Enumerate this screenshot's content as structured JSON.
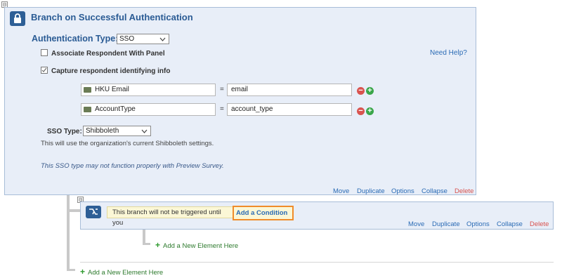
{
  "top_collapse": "⊟",
  "main": {
    "title": "Branch on Successful Authentication",
    "auth_type_label": "Authentication Type:",
    "auth_type_value": "SSO",
    "associate_label": "Associate Respondent With Panel",
    "capture_label": "Capture respondent identifying info",
    "need_help": "Need Help?",
    "rows": [
      {
        "field": "HKU Email",
        "equals": "=",
        "value": "email"
      },
      {
        "field": "AccountType",
        "equals": "=",
        "value": "account_type"
      }
    ],
    "sso_type_label": "SSO Type:",
    "sso_type_value": "Shibboleth",
    "info_text": "This will use the organization's current Shibboleth settings.",
    "warning_text": "This SSO type may not function properly with Preview Survey.",
    "actions": {
      "move": "Move",
      "duplicate": "Duplicate",
      "options": "Options",
      "collapse": "Collapse",
      "delete": "Delete"
    }
  },
  "branch": {
    "message": "This branch will not be triggered until you",
    "add_condition": "Add a Condition",
    "actions": {
      "move": "Move",
      "duplicate": "Duplicate",
      "options": "Options",
      "collapse": "Collapse",
      "delete": "Delete"
    }
  },
  "add_element_inner": "Add a New Element Here",
  "add_element_outer": "Add a New Element Here",
  "colors": {
    "accent": "#2a5b94",
    "panel_bg": "#e8eef8",
    "link": "#2a6bb5",
    "delete": "#d9534f",
    "highlight": "#f08c2a",
    "add_green": "#2d7a2d"
  },
  "icons": [
    "lock-icon",
    "branch-icon",
    "checkbox-checked-icon",
    "checkbox-empty-icon",
    "minus-circle-icon",
    "plus-circle-icon",
    "chevron-down-icon",
    "field-tag-icon",
    "plus-icon"
  ]
}
